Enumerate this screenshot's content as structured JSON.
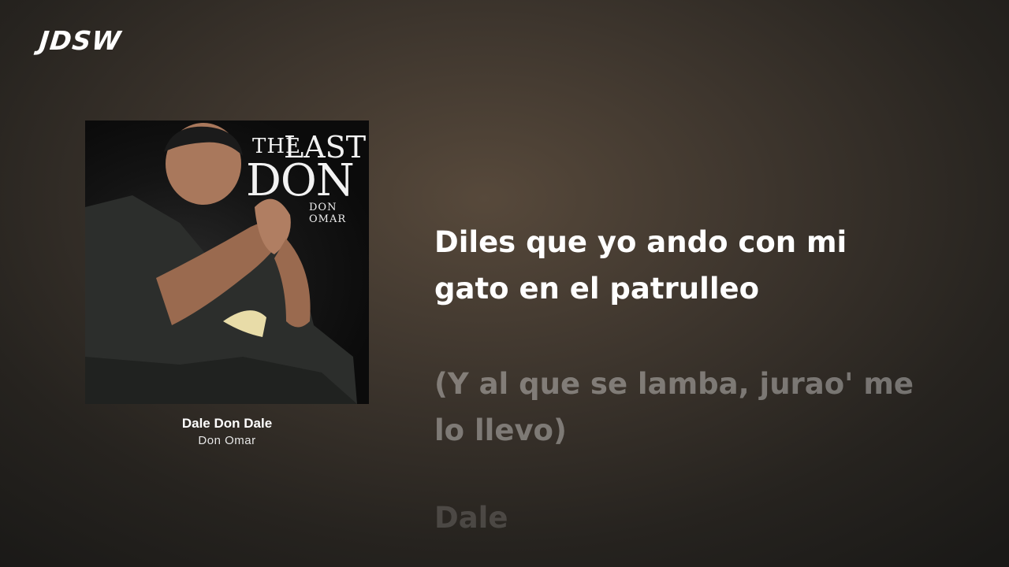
{
  "channel": {
    "logo_text": "JDSW"
  },
  "album": {
    "cover_title_the": "THE",
    "cover_title_last": "LAST",
    "cover_title_don": "DON",
    "cover_artist": "DON OMAR"
  },
  "track": {
    "title": "Dale Don Dale",
    "artist": "Don Omar"
  },
  "lyrics": {
    "current": "Diles que yo ando con mi\ngato en el patrulleo",
    "next": "(Y al que se lamba, jurao' me\nlo llevo)",
    "later": "Dale"
  }
}
